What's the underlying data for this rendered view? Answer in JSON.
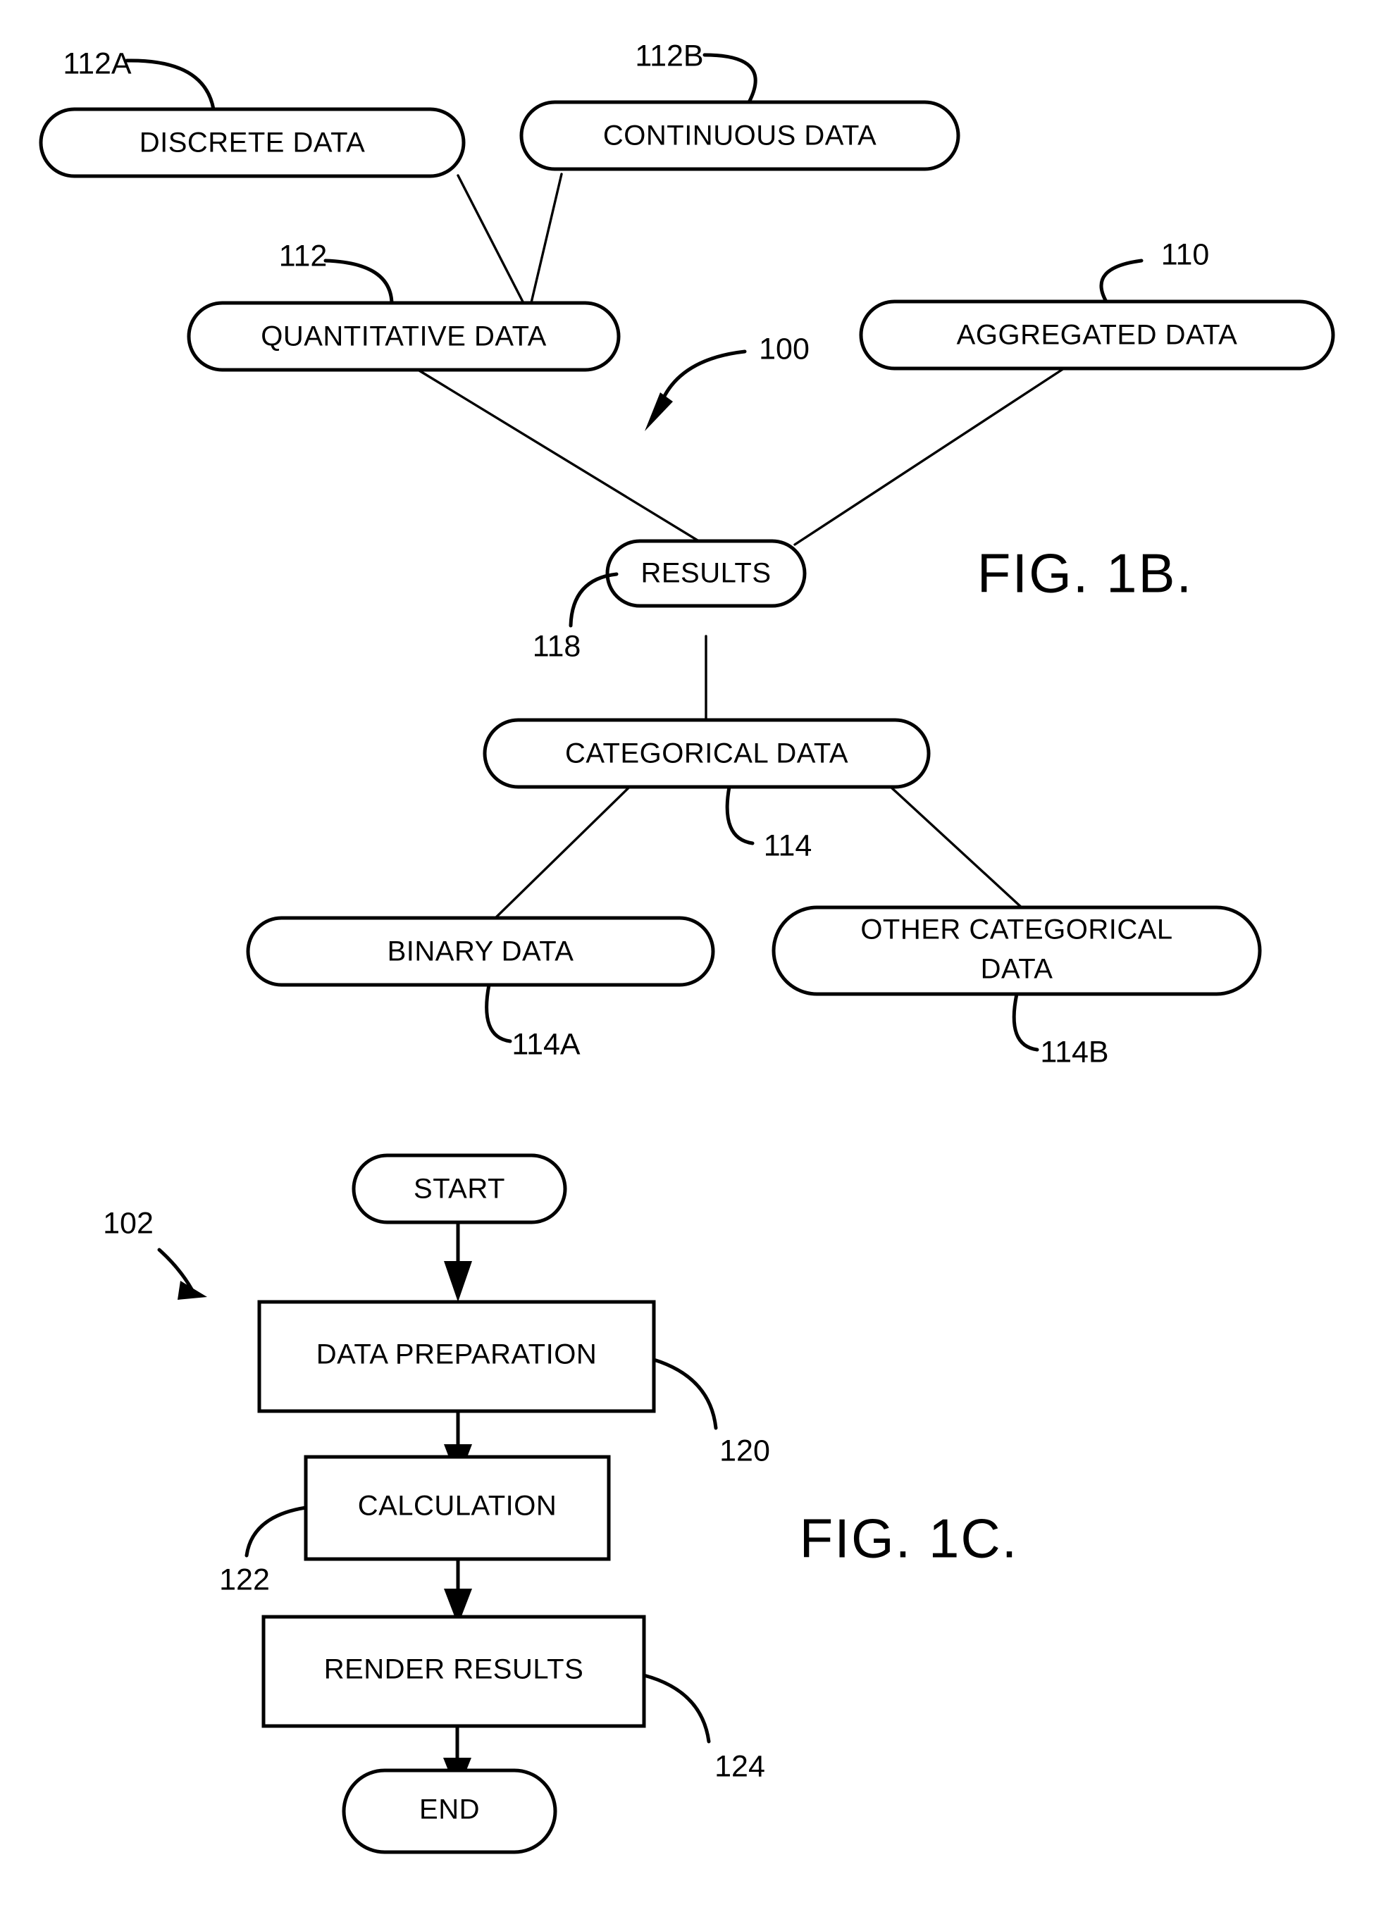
{
  "document": {
    "type": "patent-drawing-sheet",
    "figures": [
      "FIG. 1B.",
      "FIG. 1C."
    ]
  },
  "fig1b": {
    "caption": "FIG. 1B.",
    "system_ref": "100",
    "nodes": [
      {
        "id": "discrete",
        "label": "DISCRETE DATA",
        "ref": "112A"
      },
      {
        "id": "continuous",
        "label": "CONTINUOUS DATA",
        "ref": "112B"
      },
      {
        "id": "quantitative",
        "label": "QUANTITATIVE DATA",
        "ref": "112"
      },
      {
        "id": "aggregated",
        "label": "AGGREGATED DATA",
        "ref": "110"
      },
      {
        "id": "results",
        "label": "RESULTS",
        "ref": "118"
      },
      {
        "id": "categorical",
        "label": "CATEGORICAL DATA",
        "ref": "114"
      },
      {
        "id": "binary",
        "label": "BINARY DATA",
        "ref": "114A"
      },
      {
        "id": "othercat1",
        "label": "OTHER CATEGORICAL",
        "ref": "114B"
      },
      {
        "id": "othercat2",
        "label": "DATA",
        "ref": ""
      }
    ],
    "edges": [
      {
        "from": "discrete",
        "to": "quantitative"
      },
      {
        "from": "continuous",
        "to": "quantitative"
      },
      {
        "from": "quantitative",
        "to": "results"
      },
      {
        "from": "aggregated",
        "to": "results"
      },
      {
        "from": "results",
        "to": "categorical"
      },
      {
        "from": "categorical",
        "to": "binary"
      },
      {
        "from": "categorical",
        "to": "othercat1"
      }
    ]
  },
  "fig1c": {
    "caption": "FIG. 1C.",
    "process_ref": "102",
    "steps": [
      {
        "id": "start",
        "label": "START",
        "shape": "terminator",
        "ref": ""
      },
      {
        "id": "prep",
        "label": "DATA PREPARATION",
        "shape": "process",
        "ref": "120"
      },
      {
        "id": "calc",
        "label": "CALCULATION",
        "shape": "process",
        "ref": "122"
      },
      {
        "id": "render",
        "label": "RENDER RESULTS",
        "shape": "process",
        "ref": "124"
      },
      {
        "id": "end",
        "label": "END",
        "shape": "terminator",
        "ref": ""
      }
    ],
    "flow": [
      "start",
      "prep",
      "calc",
      "render",
      "end"
    ]
  },
  "colors": {
    "ink": "#000000",
    "paper": "#ffffff"
  }
}
